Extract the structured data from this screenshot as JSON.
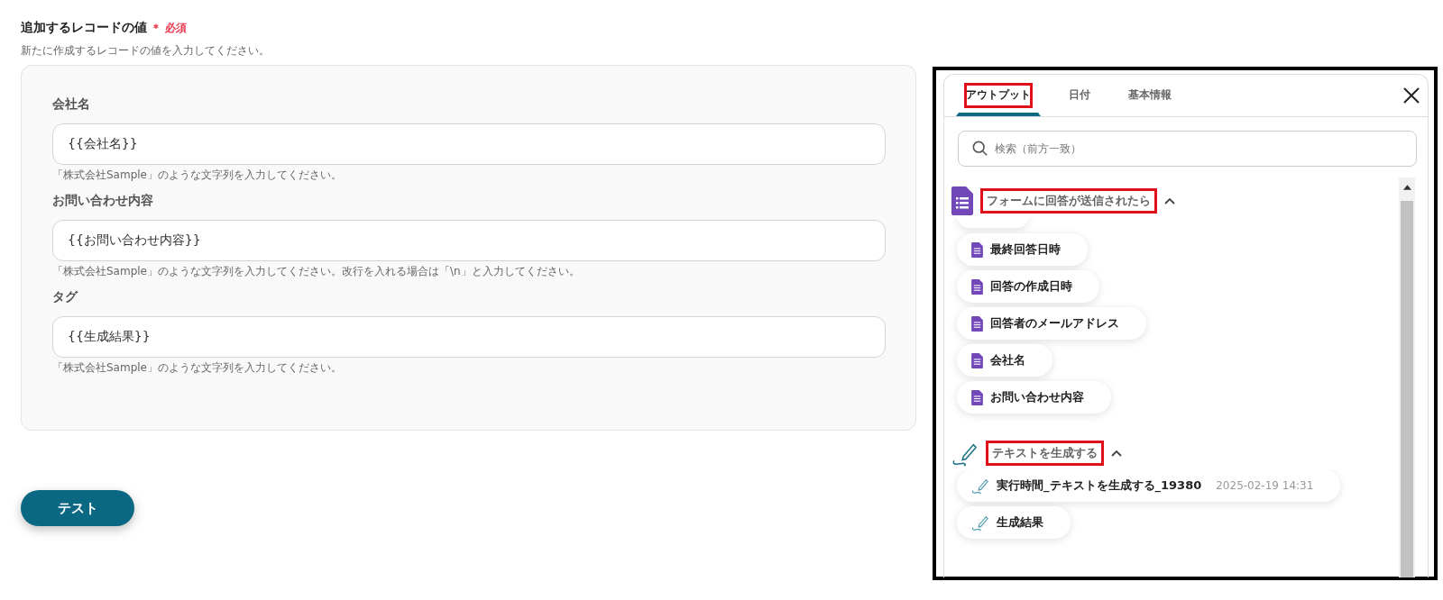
{
  "form": {
    "title": "追加するレコードの値",
    "required": "＊ 必須",
    "description": "新たに作成するレコードの値を入力してください。",
    "fields": [
      {
        "label": "会社名",
        "value": "{{会社名}}",
        "hint": "「株式会社Sample」のような文字列を入力してください。"
      },
      {
        "label": "お問い合わせ内容",
        "value": "{{お問い合わせ内容}}",
        "hint": "「株式会社Sample」のような文字列を入力してください。改行を入れる場合は「\\n」と入力してください。"
      },
      {
        "label": "タグ",
        "value": "{{生成結果}}",
        "hint": "「株式会社Sample」のような文字列を入力してください。"
      }
    ],
    "button": "テスト"
  },
  "panel": {
    "tabs": [
      {
        "label": "アウトプット",
        "selected": true,
        "highlighted": true
      },
      {
        "label": "日付",
        "selected": false,
        "highlighted": false
      },
      {
        "label": "基本情報",
        "selected": false,
        "highlighted": false
      }
    ],
    "search": {
      "placeholder": "検索（前方一致）"
    },
    "groups": [
      {
        "kind": "form",
        "title": "フォームに回答が送信されたら",
        "expanded": true,
        "highlighted": true,
        "items": [
          {
            "label": "最終回答日時"
          },
          {
            "label": "回答の作成日時"
          },
          {
            "label": "回答者のメールアドレス"
          },
          {
            "label": "会社名"
          },
          {
            "label": "お問い合わせ内容"
          }
        ]
      },
      {
        "kind": "ai",
        "title": "テキストを生成する",
        "expanded": true,
        "highlighted": true,
        "items": [
          {
            "label": "実行時間_テキストを生成する_19380",
            "meta": "2025-02-19 14:31"
          },
          {
            "label": "生成結果"
          }
        ]
      }
    ]
  }
}
